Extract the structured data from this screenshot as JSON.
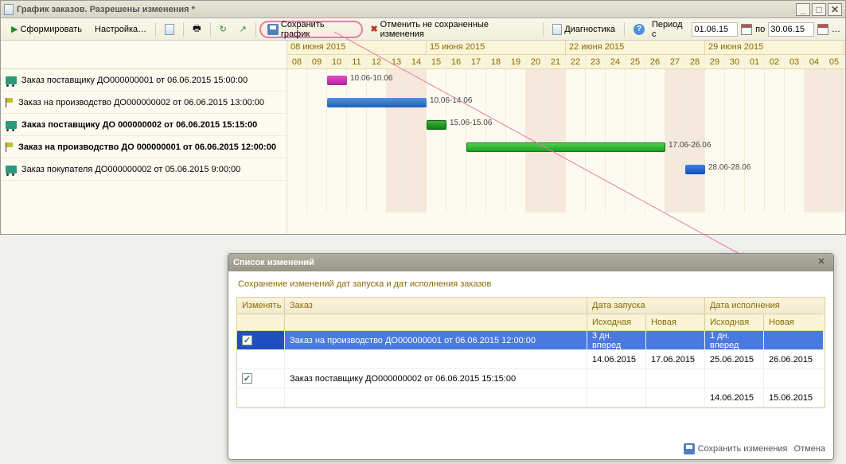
{
  "window": {
    "title": "График заказов. Разрешены изменения *"
  },
  "toolbar": {
    "generate": "Сформировать",
    "settings": "Настройка…",
    "save_chart": "Сохранить график",
    "cancel_changes": "Отменить не сохраненные изменения",
    "diagnostics": "Диагностика",
    "period_label": "Период с",
    "period_to": "по",
    "period_from": "01.06.15",
    "period_to_val": "30.06.15"
  },
  "gantt": {
    "date_groups": [
      "08 июня 2015",
      "15 июня 2015",
      "22 июня 2015",
      "29 июня 2015"
    ],
    "days": [
      "08",
      "09",
      "10",
      "11",
      "12",
      "13",
      "14",
      "15",
      "16",
      "17",
      "18",
      "19",
      "20",
      "21",
      "22",
      "23",
      "24",
      "25",
      "26",
      "27",
      "28",
      "29",
      "30",
      "01",
      "02",
      "03",
      "04",
      "05"
    ],
    "weekends": [
      5,
      6,
      12,
      13,
      19,
      20,
      26,
      27
    ],
    "rows": [
      {
        "icon": "truck",
        "label": "Заказ поставщику ДО000000001 от 06.06.2015 15:00:00",
        "bold": false
      },
      {
        "icon": "flag",
        "label": "Заказ на производство ДО000000002 от 06.06.2015 13:00:00",
        "bold": false
      },
      {
        "icon": "truck",
        "label": "Заказ поставщику ДО 000000002 от 06.06.2015 15:15:00",
        "bold": true
      },
      {
        "icon": "flag",
        "label": "Заказ на производство ДО 000000001 от 06.06.2015 12:00:00",
        "bold": true
      },
      {
        "icon": "truck",
        "label": "Заказ покупателя ДО000000002 от 05.06.2015 9:00:00",
        "bold": false
      }
    ],
    "bars": [
      {
        "row": 0,
        "start": 2,
        "len": 1,
        "cls": "magenta",
        "label": "10.06-10.06"
      },
      {
        "row": 1,
        "start": 2,
        "len": 5,
        "cls": "blue",
        "label": "10.06-14.06"
      },
      {
        "row": 2,
        "start": 7,
        "len": 1,
        "cls": "green-d",
        "label": "15.06-15.06"
      },
      {
        "row": 3,
        "start": 9,
        "len": 10,
        "cls": "green",
        "label": "17.06-26.06"
      },
      {
        "row": 4,
        "start": 20,
        "len": 1,
        "cls": "blue-s",
        "label": "28.06-28.06"
      }
    ]
  },
  "popup": {
    "title": "Список изменений",
    "subtitle": "Сохранение изменений дат запуска и дат исполнения заказов",
    "headers": {
      "change": "Изменять",
      "order": "Заказ",
      "start_date": "Дата запуска",
      "exec_date": "Дата исполнения",
      "original": "Исходная",
      "new": "Новая"
    },
    "rows": [
      {
        "checked": true,
        "order": "Заказ на производство ДО000000001 от 06.06.2015 12:00:00",
        "start_orig": "3 дн. вперед",
        "start_new": "",
        "exec_orig": "1 дн. вперед",
        "exec_new": "",
        "sub": {
          "start_orig": "14.06.2015",
          "start_new": "17.06.2015",
          "exec_orig": "25.06.2015",
          "exec_new": "26.06.2015"
        }
      },
      {
        "checked": true,
        "order": "Заказ поставщику ДО000000002 от 06.06.2015 15:15:00",
        "start_orig": "",
        "start_new": "",
        "exec_orig": "",
        "exec_new": "",
        "sub": {
          "start_orig": "",
          "start_new": "",
          "exec_orig": "14.06.2015",
          "exec_new": "15.06.2015"
        }
      }
    ],
    "save_btn": "Сохранить изменения",
    "cancel_btn": "Отмена"
  }
}
